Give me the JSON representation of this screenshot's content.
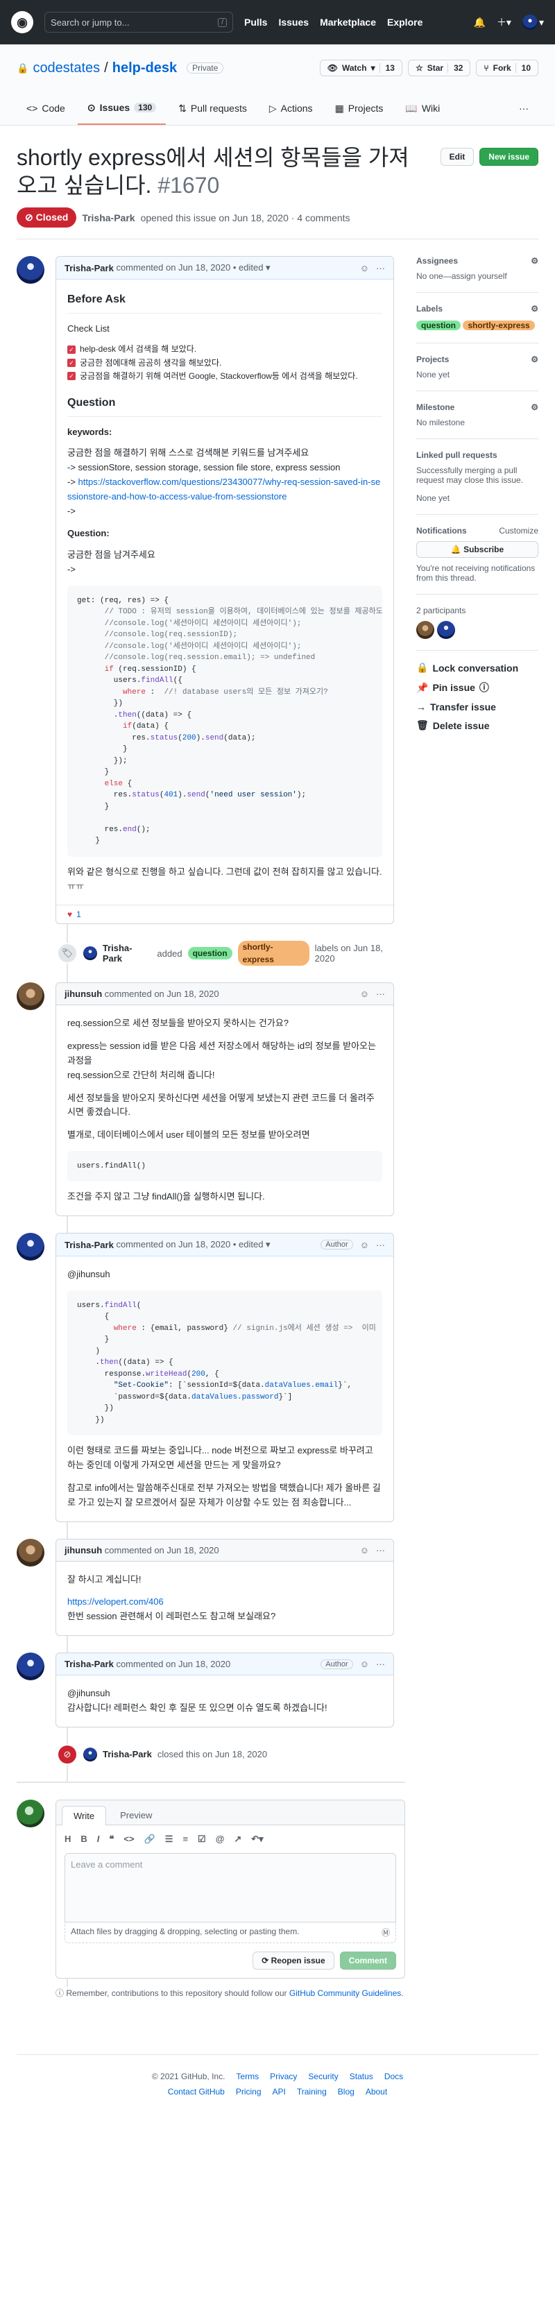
{
  "nav": {
    "search_placeholder": "Search or jump to...",
    "slash": "/",
    "links": [
      "Pulls",
      "Issues",
      "Marketplace",
      "Explore"
    ]
  },
  "repo": {
    "owner": "codestates",
    "name": "help-desk",
    "visibility": "Private",
    "watch": "Watch",
    "watch_count": "13",
    "star": "Star",
    "star_count": "32",
    "fork": "Fork",
    "fork_count": "10"
  },
  "tabs": [
    {
      "label": "Code"
    },
    {
      "label": "Issues",
      "count": "130"
    },
    {
      "label": "Pull requests"
    },
    {
      "label": "Actions"
    },
    {
      "label": "Projects"
    },
    {
      "label": "Wiki"
    }
  ],
  "issue": {
    "title": "shortly express에서 세션의 항목들을 가져오고 싶습니다.",
    "number": "#1670",
    "edit": "Edit",
    "new_issue": "New issue",
    "state": "Closed",
    "author": "Trisha-Park",
    "meta": "opened this issue on Jun 18, 2020 · 4 comments"
  },
  "c1": {
    "author": "Trisha-Park",
    "meta": "commented on Jun 18, 2020 • edited ▾",
    "h_before": "Before Ask",
    "h_check": "Check List",
    "checks": [
      "help-desk 에서 검색을 해 보았다.",
      "궁금한 점에대해 곰곰히 생각을 해보았다.",
      "궁금점을 해결하기 위해 여러번 Google, Stackoverflow등 에서 검색을 해보았다."
    ],
    "h_question": "Question",
    "kw_label": "keywords:",
    "kw_text": "궁금한 점을 해결하기 위해 스스로 검색해본 키워드를 남겨주세요",
    "kw_line1": "-> sessionStore, session storage, session file store, express session",
    "kw_arrow": "-> ",
    "kw_link": "https://stackoverflow.com/questions/23430077/why-req-session-saved-in-sessionstore-and-how-to-access-value-from-sessionstore",
    "kw_end": "->",
    "q_label": "Question:",
    "q_text": "궁금한 점을 남겨주세요",
    "q_arrow": "->",
    "outro": "위와 같은 형식으로 진행을 하고 싶습니다. 그런데 값이 전혀 잡히지를 않고 있습니다.",
    "outro2": "ㅠㅠ",
    "reaction_count": "1"
  },
  "ev_label": {
    "actor": "Trisha-Park",
    "added": "added",
    "l1": "question",
    "l2": "shortly-express",
    "tail": "labels on Jun 18, 2020"
  },
  "c2": {
    "author": "jihunsuh",
    "meta": "commented on Jun 18, 2020",
    "p1": "req.session으로 세션 정보들을 받아오지 못하시는 건가요?",
    "p2": "express는 session id를 받은 다음 세션 저장소에서 해당하는 id의 정보를 받아오는 과정을",
    "p3": "req.session으로 간단히 처리해 줍니다!",
    "p4": "세션 정보들을 받아오지 못하신다면 세션을 어떻게 보냈는지 관련 코드를 더 올려주시면 좋겠습니다.",
    "p5": "별개로, 데이터베이스에서 user 테이블의 모든 정보를 받아오려면",
    "code": "users.findAll()",
    "p6": "조건을 주지 않고 그냥 findAll()을 실행하시면 됩니다."
  },
  "c3": {
    "author": "Trisha-Park",
    "meta": "commented on Jun 18, 2020 • edited ▾",
    "role": "Author",
    "mention": "@jihunsuh",
    "p1": "이런 형태로 코드를 짜보는 중입니다... node 버전으로 짜보고 express로 바꾸려고 하는 중인데 이렇게 가져오면 세션을 만드는 게 맞을까요?",
    "p2": "참고로 info에서는 말씀해주신대로 전부 가져오는 방법을 택했습니다! 제가 올바른 길로 가고 있는지 잘 모르겠어서 질문 자체가 이상할 수도 있는 점 죄송합니다..."
  },
  "c4": {
    "author": "jihunsuh",
    "meta": "commented on Jun 18, 2020",
    "p1": "잘 하시고 계십니다!",
    "link": "https://velopert.com/406",
    "p2": "한번 session 관련해서 이 레퍼런스도 참고해 보실래요?"
  },
  "c5": {
    "author": "Trisha-Park",
    "meta": "commented on Jun 18, 2020",
    "role": "Author",
    "mention": "@jihunsuh",
    "p1": "감사합니다! 레퍼런스 확인 후 질문 또 있으면 이슈 열도록 하겠습니다!"
  },
  "ev_close": {
    "actor": "Trisha-Park",
    "text": "closed this on Jun 18, 2020"
  },
  "newcomment": {
    "write": "Write",
    "preview": "Preview",
    "placeholder": "Leave a comment",
    "attach": "Attach files by dragging & dropping, selecting or pasting them.",
    "reopen": "Reopen issue",
    "submit": "Comment",
    "note_pre": "Remember, contributions to this repository should follow our ",
    "note_link": "GitHub Community Guidelines",
    "note_end": "."
  },
  "sidebar": {
    "assignees": "Assignees",
    "assignees_val": "No one—assign yourself",
    "labels": "Labels",
    "l1": "question",
    "l2": "shortly-express",
    "projects": "Projects",
    "projects_val": "None yet",
    "milestone": "Milestone",
    "milestone_val": "No milestone",
    "linked": "Linked pull requests",
    "linked_desc": "Successfully merging a pull request may close this issue.",
    "linked_val": "None yet",
    "notifications": "Notifications",
    "customize": "Customize",
    "subscribe": "Subscribe",
    "notif_desc": "You're not receiving notifications from this thread.",
    "participants": "2 participants",
    "lock": "Lock conversation",
    "pin": "Pin issue",
    "transfer": "Transfer issue",
    "delete": "Delete issue"
  },
  "footer": {
    "copy": "© 2021 GitHub, Inc.",
    "row1": [
      "Terms",
      "Privacy",
      "Security",
      "Status",
      "Docs"
    ],
    "row2": [
      "Contact GitHub",
      "Pricing",
      "API",
      "Training",
      "Blog",
      "About"
    ]
  },
  "colors": {
    "closed": "#cb2431",
    "green": "#2ea44f",
    "label_question": "#7fe39b",
    "label_shortly": "#f5b574"
  }
}
